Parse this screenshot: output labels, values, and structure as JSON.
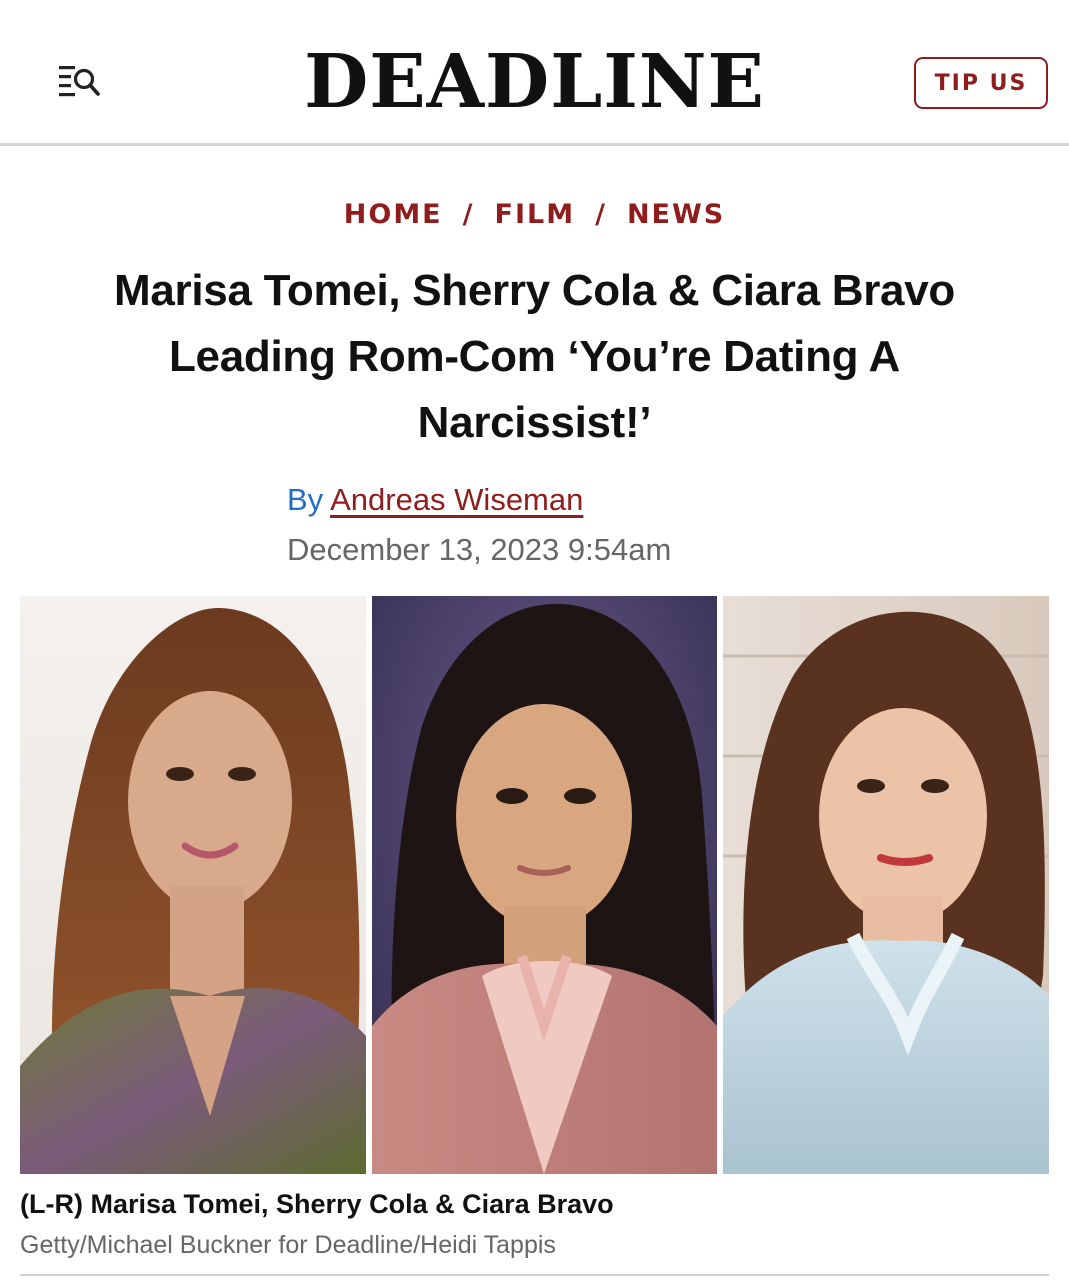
{
  "header": {
    "menu_icon": "menu-search-icon",
    "logo": "DEADLINE",
    "tip_button": "TIP US"
  },
  "breadcrumb": {
    "items": [
      "HOME",
      "FILM",
      "NEWS"
    ],
    "separator": "/"
  },
  "article": {
    "headline_lines": [
      "Marisa Tomei, Sherry Cola & Ciara Bravo",
      "Leading Rom-Com ‘You’re Dating A",
      "Narcissist!’"
    ],
    "byline_prefix": "By",
    "author": "Andreas Wiseman",
    "date": "December 13, 2023 9:54am"
  },
  "image": {
    "caption": "(L-R) Marisa Tomei, Sherry Cola & Ciara Bravo",
    "credit": "Getty/Michael Buckner for Deadline/Heidi Tappis"
  },
  "colors": {
    "accent": "#8f1d1d",
    "byline_blue": "#1f6fc4",
    "meta_gray": "#666666"
  }
}
